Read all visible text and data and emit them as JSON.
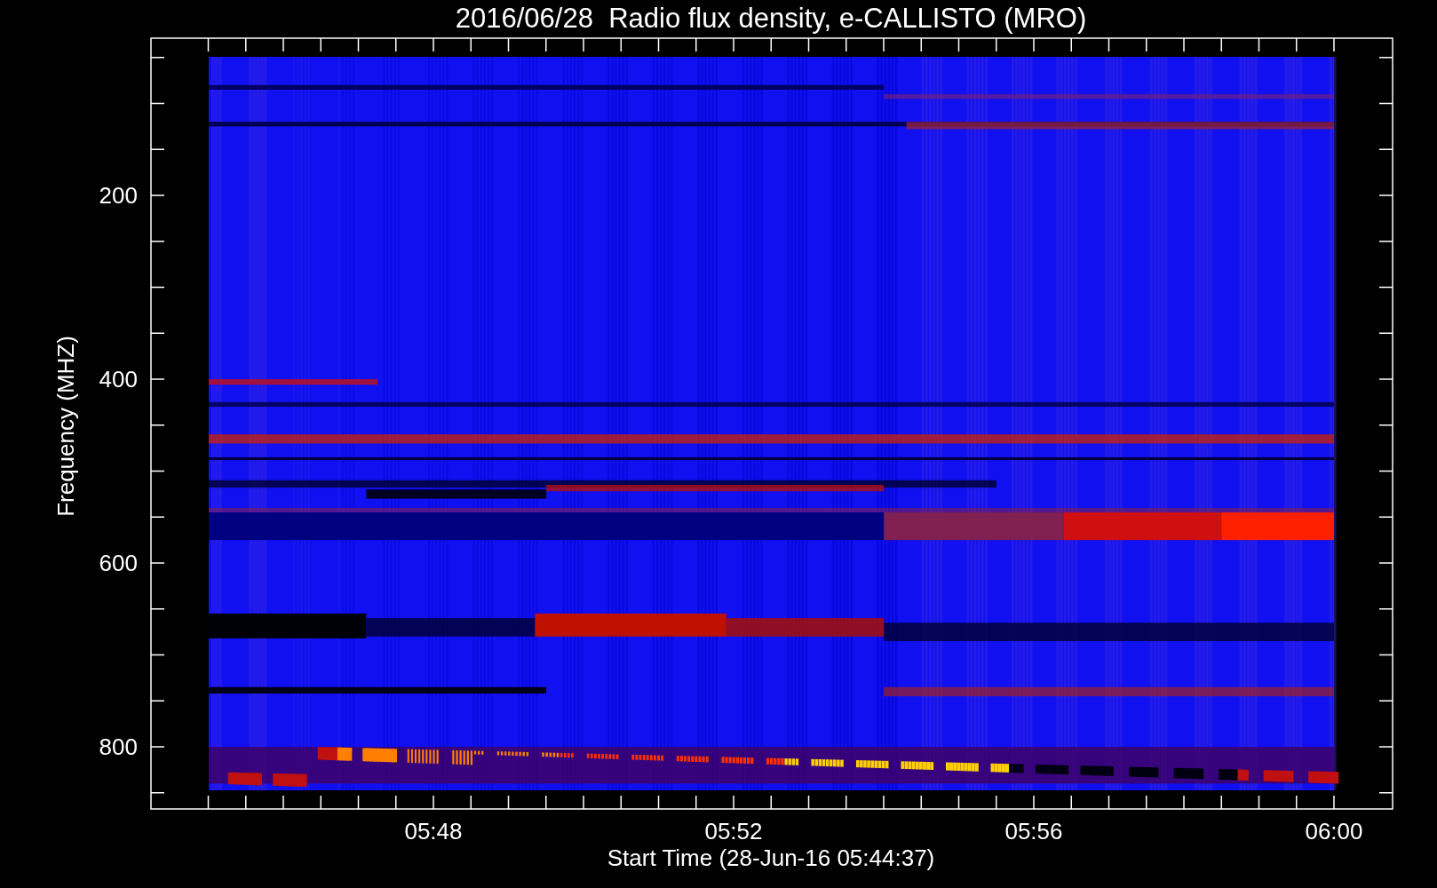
{
  "chart": {
    "title": "2016/06/28  Radio flux density, e-CALLISTO (MRO)",
    "y_axis": {
      "label": "Frequency (MHZ)",
      "ticks": [
        "200",
        "400",
        "600",
        "800"
      ]
    },
    "x_axis": {
      "label": "Start Time (28-Jun-16 05:44:37)",
      "ticks": [
        "05:48",
        "05:52",
        "05:56",
        "06:00"
      ]
    }
  }
}
